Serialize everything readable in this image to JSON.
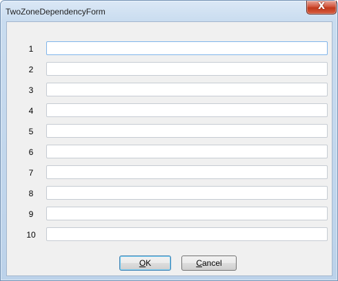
{
  "window": {
    "title": "TwoZoneDependencyForm",
    "close_glyph": "X"
  },
  "fields": [
    {
      "label": "1",
      "value": ""
    },
    {
      "label": "2",
      "value": ""
    },
    {
      "label": "3",
      "value": ""
    },
    {
      "label": "4",
      "value": ""
    },
    {
      "label": "5",
      "value": ""
    },
    {
      "label": "6",
      "value": ""
    },
    {
      "label": "7",
      "value": ""
    },
    {
      "label": "8",
      "value": ""
    },
    {
      "label": "9",
      "value": ""
    },
    {
      "label": "10",
      "value": ""
    }
  ],
  "buttons": {
    "ok": {
      "mnemonic": "O",
      "rest": "K"
    },
    "cancel": {
      "mnemonic": "C",
      "rest": "ancel"
    }
  }
}
